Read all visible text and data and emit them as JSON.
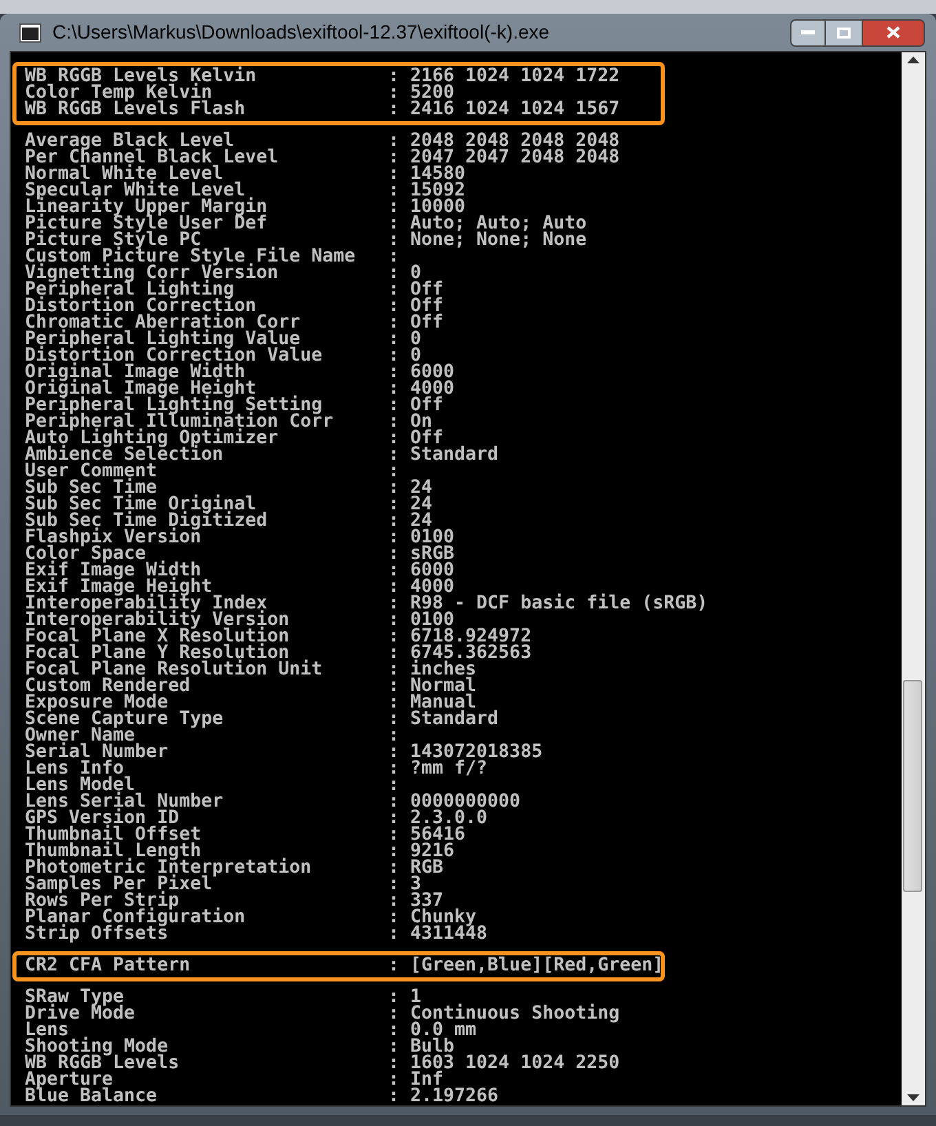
{
  "window": {
    "title": "C:\\Users\\Markus\\Downloads\\exiftool-12.37\\exiftool(-k).exe"
  },
  "groups": [
    {
      "highlighted": true,
      "lines": [
        {
          "label": "WB RGGB Levels Kelvin",
          "value": ": 2166 1024 1024 1722"
        },
        {
          "label": "Color Temp Kelvin",
          "value": ": 5200"
        },
        {
          "label": "WB RGGB Levels Flash",
          "value": ": 2416 1024 1024 1567"
        }
      ]
    },
    {
      "highlighted": false,
      "lines": [
        {
          "label": "Average Black Level",
          "value": ": 2048 2048 2048 2048"
        },
        {
          "label": "Per Channel Black Level",
          "value": ": 2047 2047 2048 2048"
        },
        {
          "label": "Normal White Level",
          "value": ": 14580"
        },
        {
          "label": "Specular White Level",
          "value": ": 15092"
        },
        {
          "label": "Linearity Upper Margin",
          "value": ": 10000"
        },
        {
          "label": "Picture Style User Def",
          "value": ": Auto; Auto; Auto"
        },
        {
          "label": "Picture Style PC",
          "value": ": None; None; None"
        },
        {
          "label": "Custom Picture Style File Name",
          "value": ":"
        },
        {
          "label": "Vignetting Corr Version",
          "value": ": 0"
        },
        {
          "label": "Peripheral Lighting",
          "value": ": Off"
        },
        {
          "label": "Distortion Correction",
          "value": ": Off"
        },
        {
          "label": "Chromatic Aberration Corr",
          "value": ": Off"
        },
        {
          "label": "Peripheral Lighting Value",
          "value": ": 0"
        },
        {
          "label": "Distortion Correction Value",
          "value": ": 0"
        },
        {
          "label": "Original Image Width",
          "value": ": 6000"
        },
        {
          "label": "Original Image Height",
          "value": ": 4000"
        },
        {
          "label": "Peripheral Lighting Setting",
          "value": ": Off"
        },
        {
          "label": "Peripheral Illumination Corr",
          "value": ": On"
        },
        {
          "label": "Auto Lighting Optimizer",
          "value": ": Off"
        },
        {
          "label": "Ambience Selection",
          "value": ": Standard"
        },
        {
          "label": "User Comment",
          "value": ":"
        },
        {
          "label": "Sub Sec Time",
          "value": ": 24"
        },
        {
          "label": "Sub Sec Time Original",
          "value": ": 24"
        },
        {
          "label": "Sub Sec Time Digitized",
          "value": ": 24"
        },
        {
          "label": "Flashpix Version",
          "value": ": 0100"
        },
        {
          "label": "Color Space",
          "value": ": sRGB"
        },
        {
          "label": "Exif Image Width",
          "value": ": 6000"
        },
        {
          "label": "Exif Image Height",
          "value": ": 4000"
        },
        {
          "label": "Interoperability Index",
          "value": ": R98 - DCF basic file (sRGB)"
        },
        {
          "label": "Interoperability Version",
          "value": ": 0100"
        },
        {
          "label": "Focal Plane X Resolution",
          "value": ": 6718.924972"
        },
        {
          "label": "Focal Plane Y Resolution",
          "value": ": 6745.362563"
        },
        {
          "label": "Focal Plane Resolution Unit",
          "value": ": inches"
        },
        {
          "label": "Custom Rendered",
          "value": ": Normal"
        },
        {
          "label": "Exposure Mode",
          "value": ": Manual"
        },
        {
          "label": "Scene Capture Type",
          "value": ": Standard"
        },
        {
          "label": "Owner Name",
          "value": ":"
        },
        {
          "label": "Serial Number",
          "value": ": 143072018385"
        },
        {
          "label": "Lens Info",
          "value": ": ?mm f/?"
        },
        {
          "label": "Lens Model",
          "value": ":"
        },
        {
          "label": "Lens Serial Number",
          "value": ": 0000000000"
        },
        {
          "label": "GPS Version ID",
          "value": ": 2.3.0.0"
        },
        {
          "label": "Thumbnail Offset",
          "value": ": 56416"
        },
        {
          "label": "Thumbnail Length",
          "value": ": 9216"
        },
        {
          "label": "Photometric Interpretation",
          "value": ": RGB"
        },
        {
          "label": "Samples Per Pixel",
          "value": ": 3"
        },
        {
          "label": "Rows Per Strip",
          "value": ": 337"
        },
        {
          "label": "Planar Configuration",
          "value": ": Chunky"
        },
        {
          "label": "Strip Offsets",
          "value": ": 4311448"
        }
      ]
    },
    {
      "highlighted": true,
      "lines": [
        {
          "label": "CR2 CFA Pattern",
          "value": ": [Green,Blue][Red,Green]"
        }
      ]
    },
    {
      "highlighted": false,
      "lines": [
        {
          "label": "SRaw Type",
          "value": ": 1"
        },
        {
          "label": "Drive Mode",
          "value": ": Continuous Shooting"
        },
        {
          "label": "Lens",
          "value": ": 0.0 mm"
        },
        {
          "label": "Shooting Mode",
          "value": ": Bulb"
        },
        {
          "label": "WB RGGB Levels",
          "value": ": 1603 1024 1024 2250"
        },
        {
          "label": "Aperture",
          "value": ": Inf"
        },
        {
          "label": "Blue Balance",
          "value": ": 2.197266"
        }
      ]
    }
  ]
}
